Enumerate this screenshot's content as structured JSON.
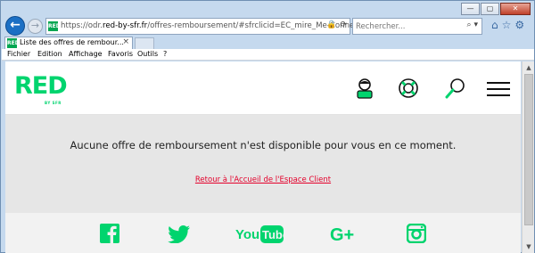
{
  "browser": {
    "url_prefix": "https://odr.",
    "url_domain": "red-by-sfr.fr",
    "url_path": "/offres-remboursement/#sfrclicid=EC_mire_Me-Connecter",
    "search_placeholder": "Rechercher...",
    "tab_title": "Liste des offres de rembour...",
    "tab_close": "×",
    "menu": [
      "Fichier",
      "Edition",
      "Affichage",
      "Favoris",
      "Outils",
      "?"
    ],
    "favicon_text": "RED"
  },
  "site": {
    "logo": "RED",
    "logo_sub": "BY SFR",
    "message": "Aucune offre de remboursement n'est disponible pour vous en ce moment.",
    "back_link": "Retour à l'Accueil de l'Espace Client",
    "social": [
      "facebook",
      "twitter",
      "youtube",
      "google-plus",
      "instagram"
    ]
  },
  "colors": {
    "brand_green": "#00d46e",
    "link_red": "#e4002b",
    "content_bg": "#e6e6e6"
  }
}
